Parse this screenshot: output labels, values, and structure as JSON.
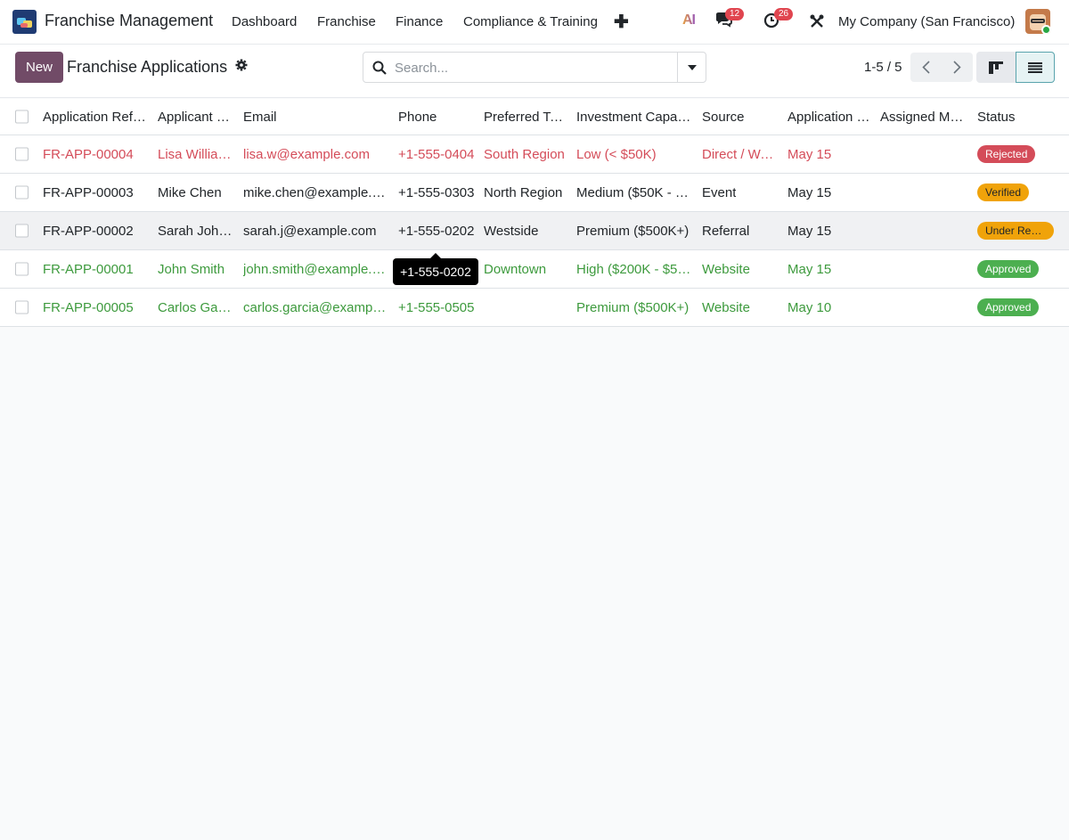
{
  "navbar": {
    "app_name": "Franchise Management",
    "links": [
      "Dashboard",
      "Franchise",
      "Finance",
      "Compliance & Training"
    ],
    "ai_label": "AI",
    "messages_count": "12",
    "activities_count": "26",
    "company": "My Company (San Francisco)"
  },
  "control": {
    "new_label": "New",
    "breadcrumb": "Franchise Applications",
    "search_placeholder": "Search...",
    "pager": "1-5 / 5"
  },
  "table": {
    "columns": [
      "Application Ref…",
      "Applicant …",
      "Email",
      "Phone",
      "Preferred Te…",
      "Investment Capac…",
      "Source",
      "Application …",
      "Assigned Ma…",
      "Status"
    ],
    "rows": [
      {
        "ref": "FR-APP-00004",
        "applicant": "Lisa Willia…",
        "email": "lisa.w@example.com",
        "phone": "+1-555-0404",
        "territory": "South Region",
        "investment": "Low (< $50K)",
        "source": "Direct / Wa…",
        "date": "May 15",
        "manager": "",
        "status": "Rejected",
        "tone": "red",
        "status_class": "st-rejected"
      },
      {
        "ref": "FR-APP-00003",
        "applicant": "Mike Chen",
        "email": "mike.chen@example.c…",
        "phone": "+1-555-0303",
        "territory": "North Region",
        "investment": "Medium ($50K - $…",
        "source": "Event",
        "date": "May 15",
        "manager": "",
        "status": "Verified",
        "tone": "normal",
        "status_class": "st-verified"
      },
      {
        "ref": "FR-APP-00002",
        "applicant": "Sarah John…",
        "email": "sarah.j@example.com",
        "phone": "+1-555-0202",
        "territory": "Westside",
        "investment": "Premium ($500K+)",
        "source": "Referral",
        "date": "May 15",
        "manager": "",
        "status": "Under Re…",
        "tone": "normal",
        "status_class": "st-review"
      },
      {
        "ref": "FR-APP-00001",
        "applicant": "John Smith",
        "email": "john.smith@example.c…",
        "phone": "",
        "territory": "Downtown",
        "investment": "High ($200K - $50…",
        "source": "Website",
        "date": "May 15",
        "manager": "",
        "status": "Approved",
        "tone": "green",
        "status_class": "st-approved"
      },
      {
        "ref": "FR-APP-00005",
        "applicant": "Carlos Gar…",
        "email": "carlos.garcia@exampl…",
        "phone": "+1-555-0505",
        "territory": "",
        "investment": "Premium ($500K+)",
        "source": "Website",
        "date": "May 10",
        "manager": "",
        "status": "Approved",
        "tone": "green",
        "status_class": "st-approved"
      }
    ]
  },
  "tooltip": {
    "text": "+1-555-0202"
  },
  "colors": {
    "brand": "#714b67",
    "danger": "#d44c59",
    "success": "#3d9a3d",
    "warning": "#f0a30a"
  }
}
